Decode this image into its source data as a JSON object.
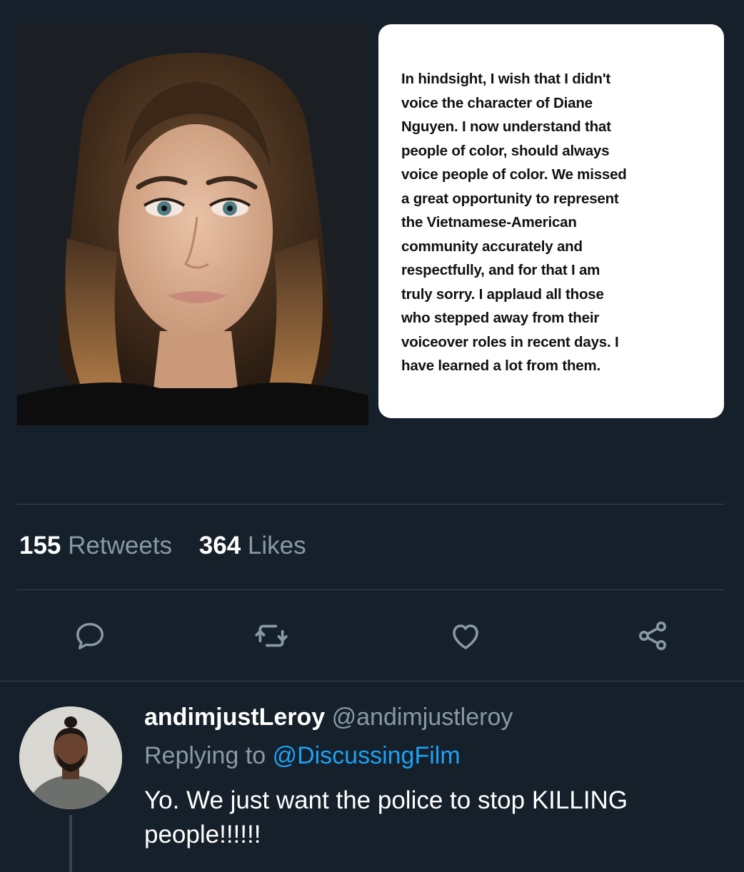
{
  "tweet": {
    "quote_text": "In hindsight, I wish that I didn't\nvoice the character of Diane\nNguyen.  I now understand that\npeople of color, should always\nvoice people of color. We missed\na great opportunity to represent\nthe Vietnamese-American\ncommunity accurately and\nrespectfully, and for that I am\ntruly sorry. I applaud all those\nwho stepped away from their\nvoiceover roles in recent days. I\nhave learned a lot from them.",
    "photo_icon": "portrait-photo",
    "stats": {
      "retweets_count": "155",
      "retweets_label": "Retweets",
      "likes_count": "364",
      "likes_label": "Likes"
    },
    "actions": [
      "reply-icon",
      "retweet-icon",
      "like-icon",
      "share-icon"
    ],
    "action_color": "#8899a6"
  },
  "reply": {
    "display_name": "andimjustLeroy",
    "handle": "@andimjustleroy",
    "replying_prefix": "Replying to",
    "replying_to": "@DiscussingFilm",
    "text": "Yo. We just want the police to stop KILLING people!!!!!!"
  },
  "colors": {
    "background": "#15202b",
    "secondary_text": "#8899a6",
    "link": "#1da1f2",
    "divider": "#38444d"
  }
}
